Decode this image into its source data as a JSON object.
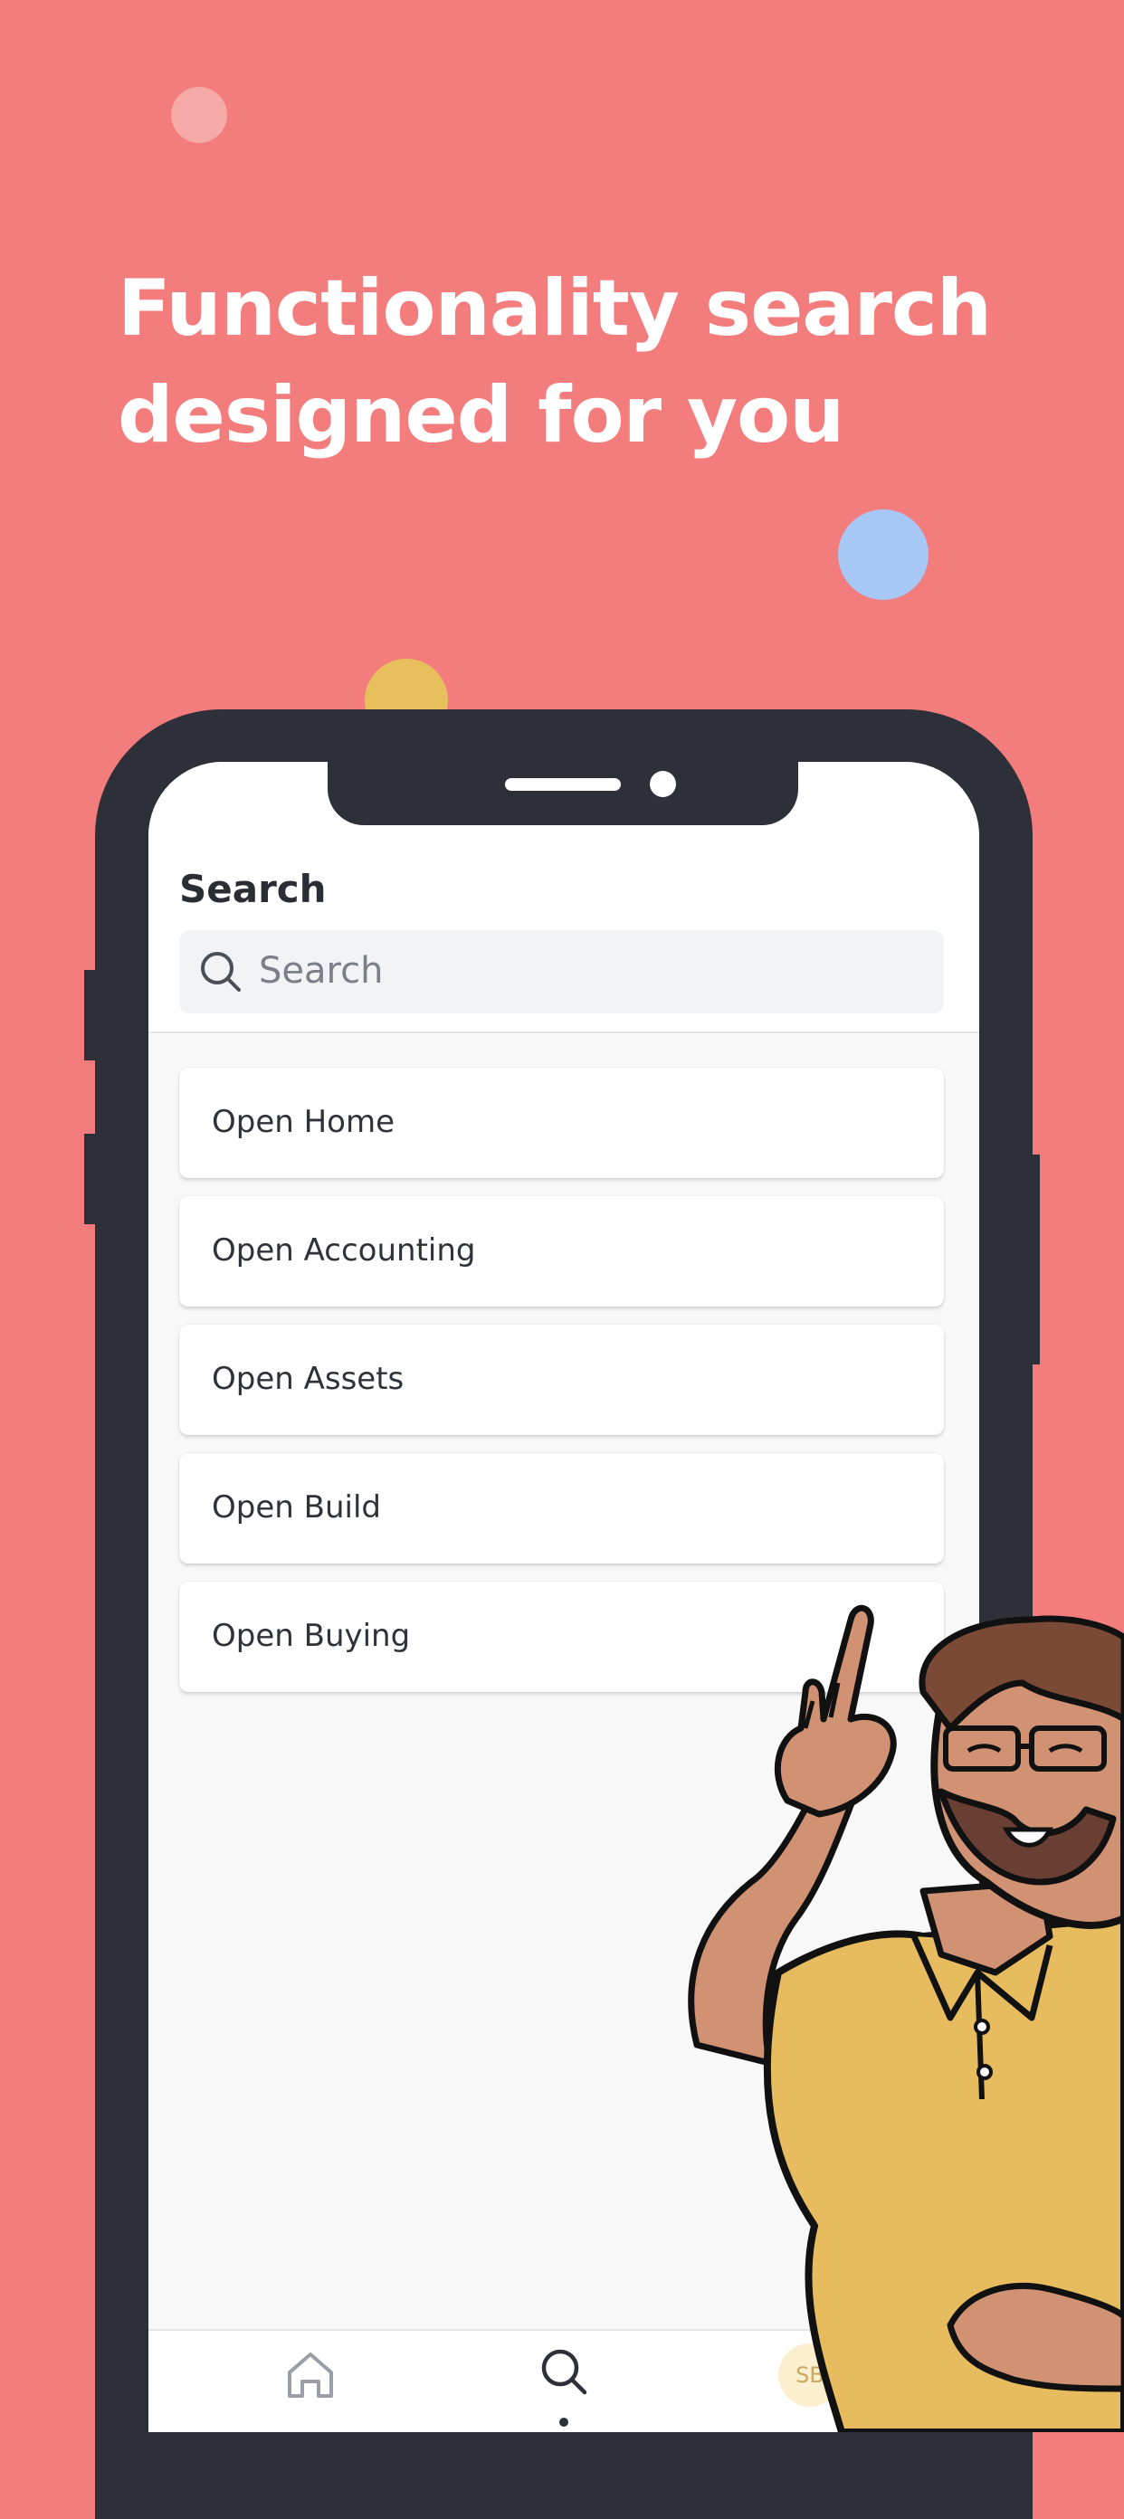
{
  "hero": {
    "line1": "Functionality search",
    "line2": "designed for you"
  },
  "app": {
    "title": "Search",
    "search": {
      "placeholder": "Search"
    },
    "results": [
      {
        "label": "Open Home"
      },
      {
        "label": "Open Accounting"
      },
      {
        "label": "Open Assets"
      },
      {
        "label": "Open Build"
      },
      {
        "label": "Open Buying"
      }
    ],
    "tabbar": {
      "items": [
        "home-icon",
        "search-icon",
        "avatar"
      ],
      "active": "search",
      "avatar_initials": "SB"
    }
  },
  "colors": {
    "background": "#f37c7c",
    "phone_frame": "#2d3038",
    "accent_blue": "#a7c8f5",
    "accent_yellow": "#e7c05d",
    "shirt": "#e6bc5e"
  }
}
